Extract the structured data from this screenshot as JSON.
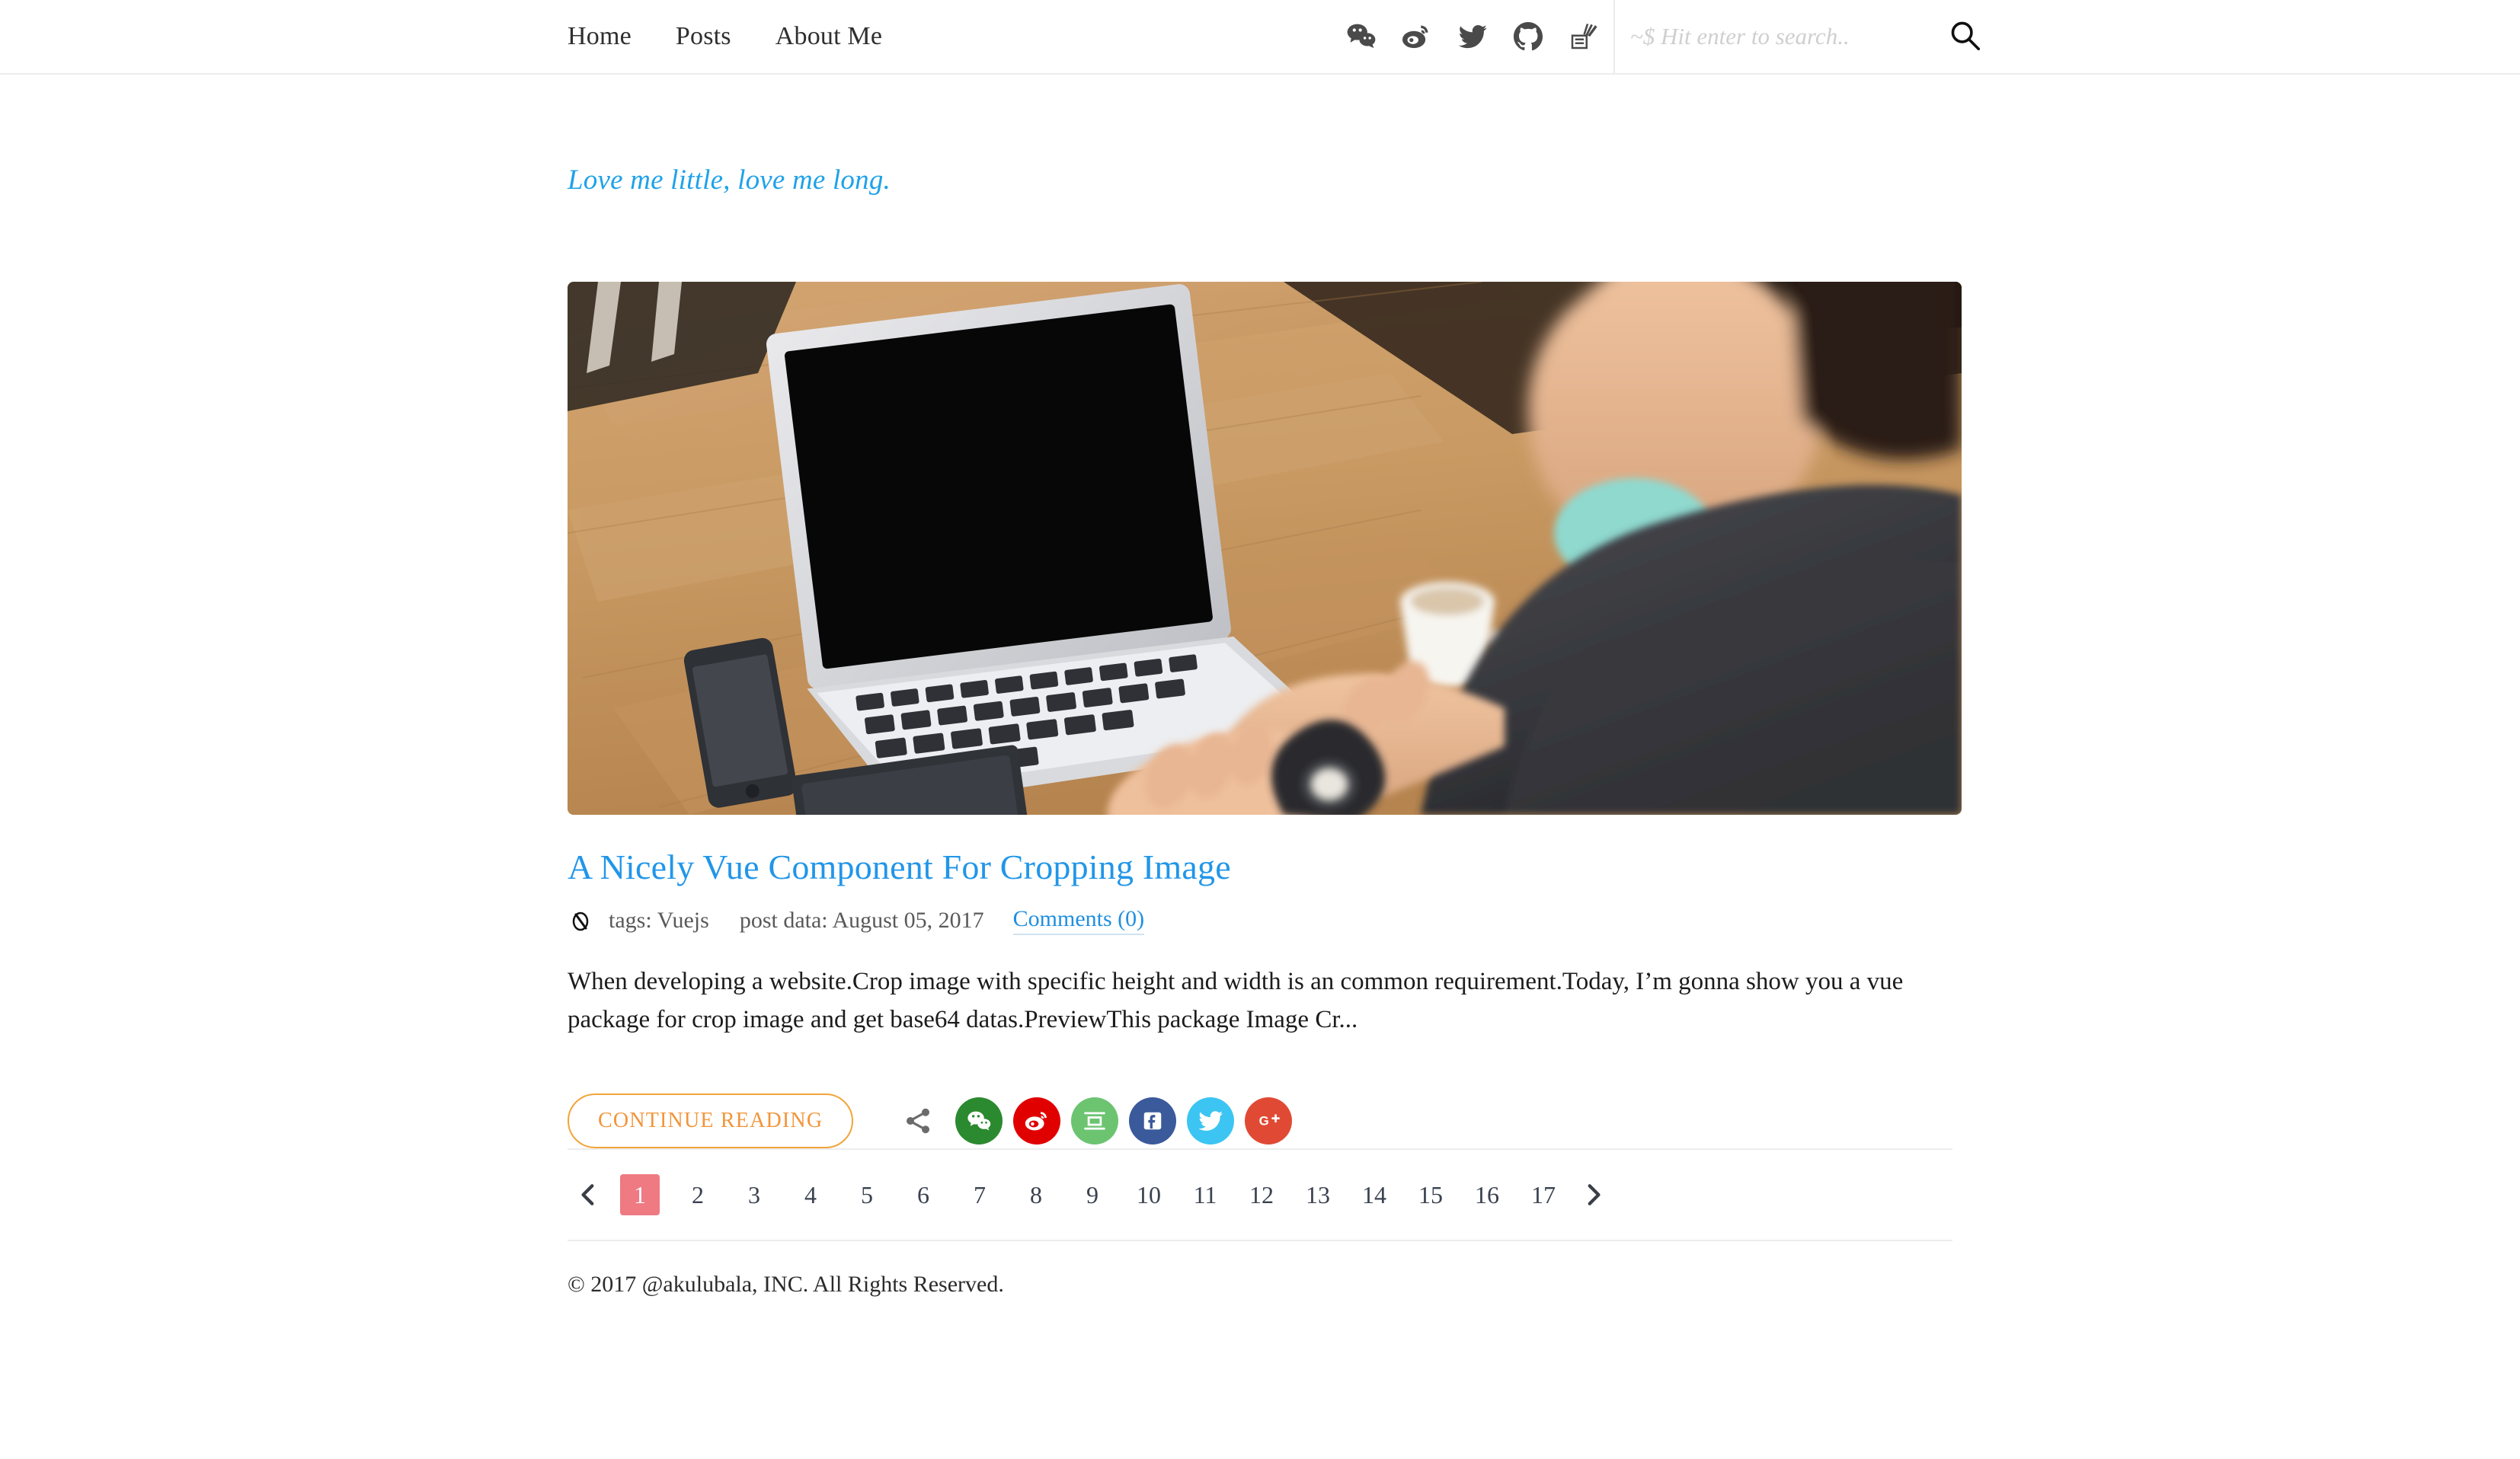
{
  "header": {
    "nav": [
      {
        "label": "Home",
        "name": "nav-home"
      },
      {
        "label": "Posts",
        "name": "nav-posts"
      },
      {
        "label": "About Me",
        "name": "nav-about-me"
      }
    ],
    "social": [
      {
        "name": "wechat-icon",
        "title": "WeChat"
      },
      {
        "name": "weibo-icon",
        "title": "Weibo"
      },
      {
        "name": "twitter-icon",
        "title": "Twitter"
      },
      {
        "name": "github-icon",
        "title": "GitHub"
      },
      {
        "name": "zhihu-icon",
        "title": "Zhihu"
      }
    ],
    "search": {
      "placeholder": "~$ Hit enter to search..",
      "value": "",
      "icon": "search-icon"
    }
  },
  "main": {
    "tagline": "Love me little, love me long.",
    "post": {
      "thumbnail_alt": "Person typing on a laptop at a wooden table with a phone and coffee cup",
      "title": "A Nicely Vue Component For Cropping Image",
      "meta": {
        "icon": "tag-loop-icon",
        "tags": "tags: Vuejs",
        "date": "post data: August 05, 2017",
        "comments": "Comments (0)"
      },
      "excerpt": "When developing a website.Crop image with specific height and width is an common requirement.Today, I’m gonna show you a vue package for crop image and get base64 datas.PreviewThis package Image Cr...",
      "continue_label": "CONTINUE READING",
      "share": {
        "icon": "share-nodes-icon",
        "buttons": [
          {
            "name": "share-wechat",
            "label": "WeChat",
            "color": "#2b8a2f"
          },
          {
            "name": "share-weibo",
            "label": "Weibo",
            "color": "#e00000"
          },
          {
            "name": "share-douban",
            "label": "Douban",
            "color": "#6cc471"
          },
          {
            "name": "share-facebook",
            "label": "Facebook",
            "color": "#3b5a9b"
          },
          {
            "name": "share-twitter",
            "label": "Twitter",
            "color": "#3cc5f2"
          },
          {
            "name": "share-googleplus",
            "label": "Google Plus",
            "color": "#e04a34"
          }
        ]
      }
    }
  },
  "pagination": {
    "prev_icon": "chevron-left-icon",
    "next_icon": "chevron-right-icon",
    "current": "1",
    "pages": [
      "1",
      "2",
      "3",
      "4",
      "5",
      "6",
      "7",
      "8",
      "9",
      "10",
      "11",
      "12",
      "13",
      "14",
      "15",
      "16",
      "17"
    ]
  },
  "footer": {
    "copyright": "© 2017 @akulubala, INC. All Rights Reserved."
  },
  "colors": {
    "accent_blue": "#2196e8",
    "tagline_blue": "#1fa2e8",
    "orange": "#f2953a",
    "active_page": "#ef7a82"
  }
}
